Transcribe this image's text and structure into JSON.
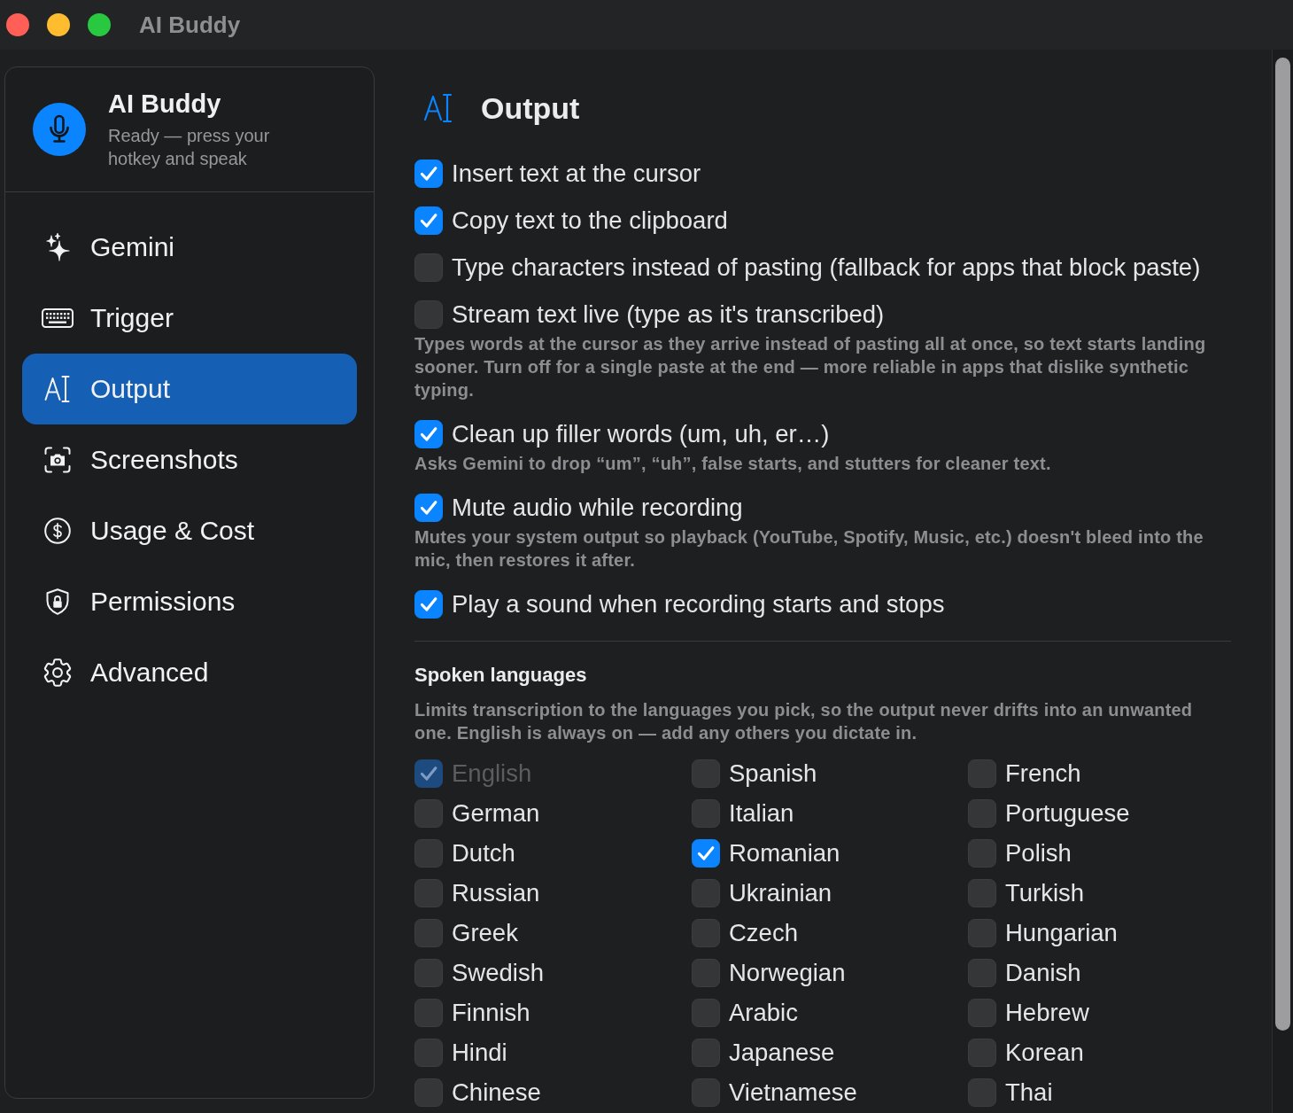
{
  "window": {
    "title": "AI Buddy"
  },
  "sidebar": {
    "app_name": "AI Buddy",
    "status": "Ready — press your hotkey and speak",
    "items": [
      {
        "label": "Gemini",
        "selected": false
      },
      {
        "label": "Trigger",
        "selected": false
      },
      {
        "label": "Output",
        "selected": true
      },
      {
        "label": "Screenshots",
        "selected": false
      },
      {
        "label": "Usage & Cost",
        "selected": false
      },
      {
        "label": "Permissions",
        "selected": false
      },
      {
        "label": "Advanced",
        "selected": false
      }
    ]
  },
  "content": {
    "title": "Output",
    "options": [
      {
        "label": "Insert text at the cursor",
        "checked": true
      },
      {
        "label": "Copy text to the clipboard",
        "checked": true
      },
      {
        "label": "Type characters instead of pasting (fallback for apps that block paste)",
        "checked": false
      },
      {
        "label": "Stream text live (type as it's transcribed)",
        "checked": false,
        "description": "Types words at the cursor as they arrive instead of pasting all at once, so text starts landing sooner. Turn off for a single paste at the end — more reliable in apps that dislike synthetic typing."
      },
      {
        "label": "Clean up filler words (um, uh, er…)",
        "checked": true,
        "description": "Asks Gemini to drop “um”, “uh”, false starts, and stutters for cleaner text."
      },
      {
        "label": "Mute audio while recording",
        "checked": true,
        "description": "Mutes your system output so playback (YouTube, Spotify, Music, etc.) doesn't bleed into the mic, then restores it after."
      },
      {
        "label": "Play a sound when recording starts and stops",
        "checked": true
      }
    ],
    "languages_section": {
      "title": "Spoken languages",
      "description": "Limits transcription to the languages you pick, so the output never drifts into an unwanted one. English is always on — add any others you dictate in.",
      "languages": [
        {
          "label": "English",
          "checked": true,
          "disabled": true
        },
        {
          "label": "Spanish",
          "checked": false,
          "disabled": false
        },
        {
          "label": "French",
          "checked": false,
          "disabled": false
        },
        {
          "label": "German",
          "checked": false,
          "disabled": false
        },
        {
          "label": "Italian",
          "checked": false,
          "disabled": false
        },
        {
          "label": "Portuguese",
          "checked": false,
          "disabled": false
        },
        {
          "label": "Dutch",
          "checked": false,
          "disabled": false
        },
        {
          "label": "Romanian",
          "checked": true,
          "disabled": false
        },
        {
          "label": "Polish",
          "checked": false,
          "disabled": false
        },
        {
          "label": "Russian",
          "checked": false,
          "disabled": false
        },
        {
          "label": "Ukrainian",
          "checked": false,
          "disabled": false
        },
        {
          "label": "Turkish",
          "checked": false,
          "disabled": false
        },
        {
          "label": "Greek",
          "checked": false,
          "disabled": false
        },
        {
          "label": "Czech",
          "checked": false,
          "disabled": false
        },
        {
          "label": "Hungarian",
          "checked": false,
          "disabled": false
        },
        {
          "label": "Swedish",
          "checked": false,
          "disabled": false
        },
        {
          "label": "Norwegian",
          "checked": false,
          "disabled": false
        },
        {
          "label": "Danish",
          "checked": false,
          "disabled": false
        },
        {
          "label": "Finnish",
          "checked": false,
          "disabled": false
        },
        {
          "label": "Arabic",
          "checked": false,
          "disabled": false
        },
        {
          "label": "Hebrew",
          "checked": false,
          "disabled": false
        },
        {
          "label": "Hindi",
          "checked": false,
          "disabled": false
        },
        {
          "label": "Japanese",
          "checked": false,
          "disabled": false
        },
        {
          "label": "Korean",
          "checked": false,
          "disabled": false
        },
        {
          "label": "Chinese",
          "checked": false,
          "disabled": false
        },
        {
          "label": "Vietnamese",
          "checked": false,
          "disabled": false
        },
        {
          "label": "Thai",
          "checked": false,
          "disabled": false
        }
      ]
    }
  }
}
